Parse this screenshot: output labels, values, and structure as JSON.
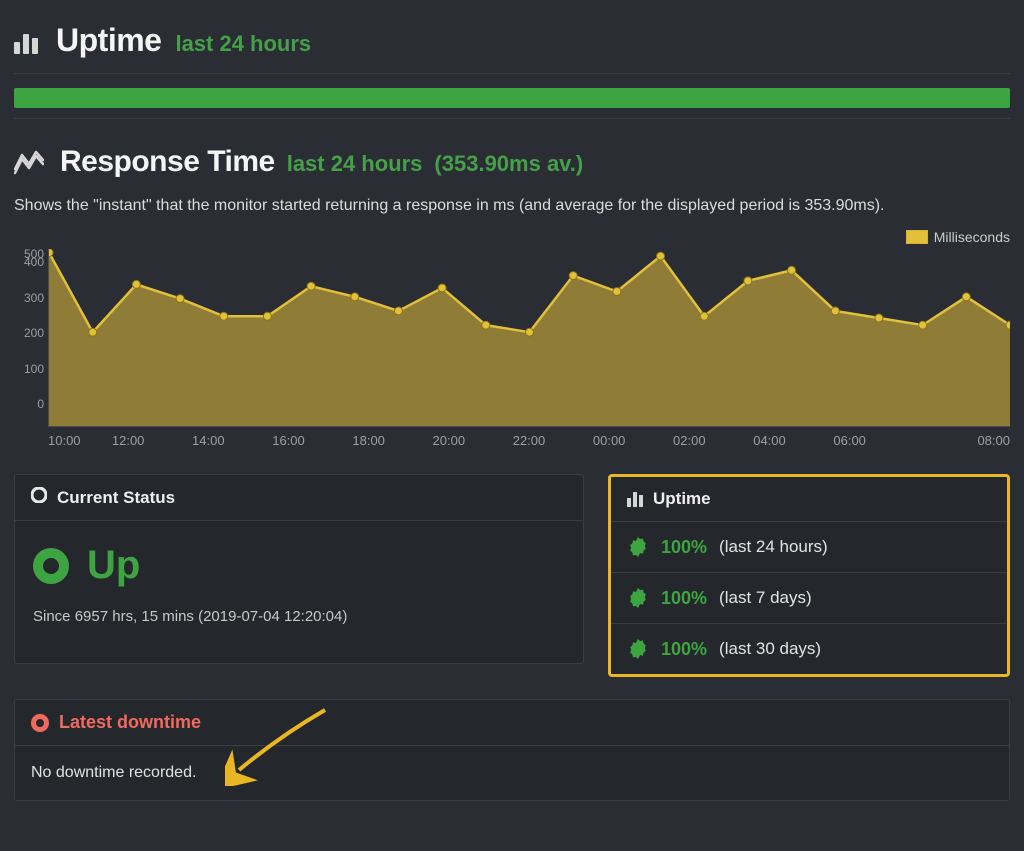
{
  "sections": {
    "uptime": {
      "title": "Uptime",
      "subtitle": "last 24 hours"
    },
    "response": {
      "title": "Response Time",
      "subtitle": "last 24 hours",
      "avg_suffix": "(353.90ms av.)",
      "description": "Shows the \"instant\" that the monitor started returning a response in ms (and average for the displayed period is 353.90ms).",
      "legend": "Milliseconds"
    },
    "current_status": {
      "heading": "Current Status",
      "status": "Up",
      "since": "Since 6957 hrs, 15 mins (2019-07-04 12:20:04)"
    },
    "uptime_panel": {
      "heading": "Uptime",
      "rows": [
        {
          "pct": "100%",
          "period": "(last 24 hours)"
        },
        {
          "pct": "100%",
          "period": "(last 7 days)"
        },
        {
          "pct": "100%",
          "period": "(last 30 days)"
        }
      ]
    },
    "downtime": {
      "heading": "Latest downtime",
      "body": "No downtime recorded."
    }
  },
  "chart_data": {
    "type": "area",
    "title": "Response Time last 24 hours (353.90ms av.)",
    "xlabel": "",
    "ylabel": "",
    "ylim": [
      0,
      500
    ],
    "y_ticks": [
      0,
      100,
      200,
      300,
      400,
      500
    ],
    "x_ticks": [
      "10:00",
      "12:00",
      "14:00",
      "16:00",
      "18:00",
      "20:00",
      "22:00",
      "00:00",
      "02:00",
      "04:00",
      "06:00",
      "08:00"
    ],
    "series": [
      {
        "name": "Milliseconds",
        "x": [
          "10:00",
          "11:00",
          "12:00",
          "13:00",
          "14:00",
          "15:00",
          "16:00",
          "17:00",
          "18:00",
          "19:00",
          "20:00",
          "21:00",
          "22:00",
          "23:00",
          "00:00",
          "01:00",
          "02:00",
          "03:00",
          "04:00",
          "05:00",
          "06:00",
          "07:00",
          "08:00"
        ],
        "values": [
          490,
          265,
          400,
          360,
          310,
          310,
          395,
          365,
          325,
          390,
          285,
          265,
          425,
          380,
          480,
          310,
          410,
          440,
          325,
          305,
          285,
          365,
          285
        ]
      }
    ],
    "color": "#e2c03a"
  }
}
